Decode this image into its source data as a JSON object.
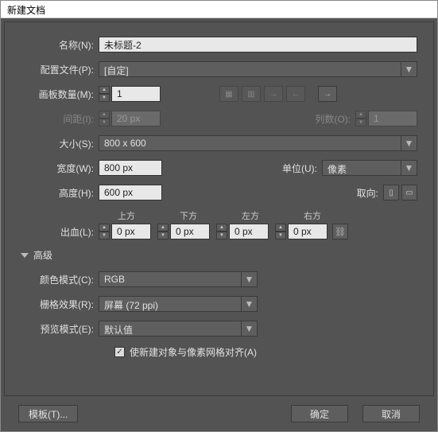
{
  "window": {
    "title": "新建文档"
  },
  "name": {
    "label": "名称(N):",
    "value": "未标题-2"
  },
  "profile": {
    "label": "配置文件(P):",
    "value": "[自定]"
  },
  "artboards": {
    "label": "画板数量(M):",
    "value": "1"
  },
  "spacing": {
    "label": "间距(I):",
    "value": "20 px"
  },
  "columns": {
    "label": "列数(O):",
    "value": "1"
  },
  "size": {
    "label": "大小(S):",
    "value": "800 x 600"
  },
  "width": {
    "label": "宽度(W):",
    "value": "800 px"
  },
  "unit": {
    "label": "单位(U):",
    "value": "像素"
  },
  "height": {
    "label": "高度(H):",
    "value": "600 px"
  },
  "orient": {
    "label": "取向:"
  },
  "bleed": {
    "label": "出血(L):",
    "top": {
      "label": "上方",
      "value": "0 px"
    },
    "bottom": {
      "label": "下方",
      "value": "0 px"
    },
    "left": {
      "label": "左方",
      "value": "0 px"
    },
    "right": {
      "label": "右方",
      "value": "0 px"
    }
  },
  "advanced": {
    "label": "高级"
  },
  "colorMode": {
    "label": "颜色模式(C):",
    "value": "RGB"
  },
  "raster": {
    "label": "栅格效果(R):",
    "value": "屏幕 (72 ppi)"
  },
  "preview": {
    "label": "预览模式(E):",
    "value": "默认值"
  },
  "alignGrid": {
    "label": "使新建对象与像素网格对齐(A)",
    "checked": true
  },
  "footer": {
    "template": "模板(T)...",
    "ok": "确定",
    "cancel": "取消"
  }
}
